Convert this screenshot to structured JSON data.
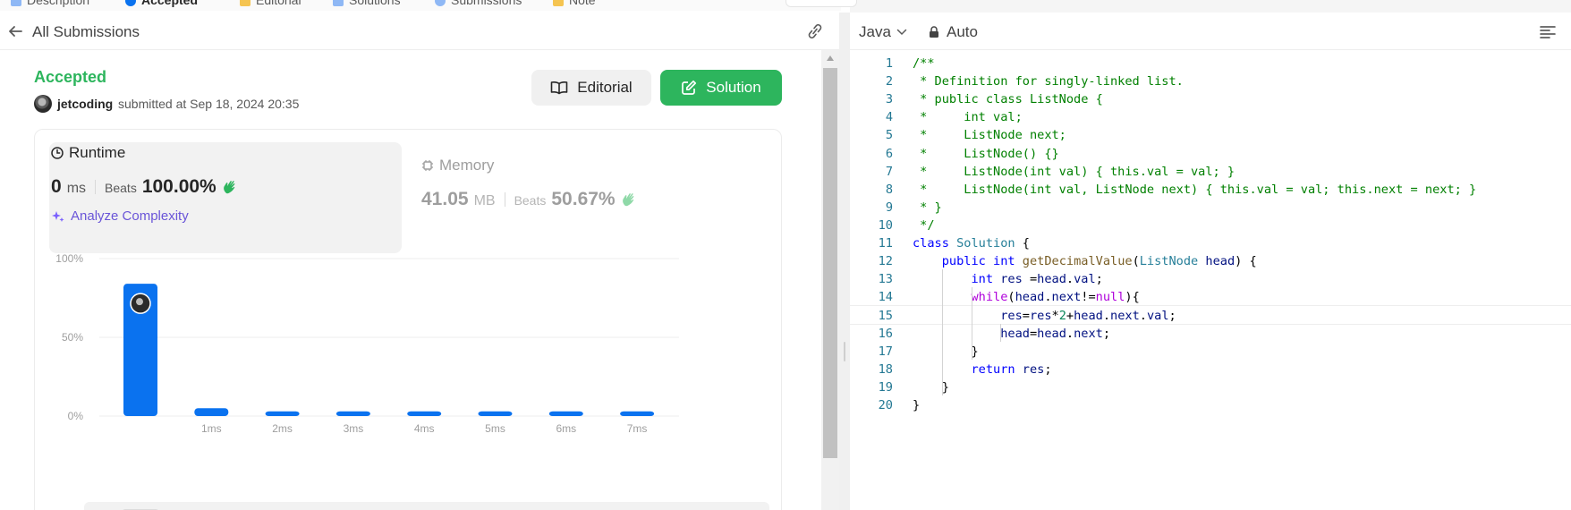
{
  "top_tabs": [
    "Description",
    "Accepted",
    "Editorial",
    "Solutions",
    "Submissions",
    "Note"
  ],
  "left_header": {
    "back_label": "All Submissions"
  },
  "submission": {
    "status": "Accepted",
    "user": "jetcoding",
    "submitted_at": "submitted at Sep 18, 2024 20:35"
  },
  "buttons": {
    "editorial": "Editorial",
    "solution": "Solution"
  },
  "runtime": {
    "title": "Runtime",
    "value": "0",
    "unit": "ms",
    "beats_label": "Beats",
    "beats": "100.00%"
  },
  "memory": {
    "title": "Memory",
    "value": "41.05",
    "unit": "MB",
    "beats_label": "Beats",
    "beats": "50.67%"
  },
  "analyze_label": "Analyze Complexity",
  "chart_data": {
    "type": "bar",
    "categories": [
      "",
      "1ms",
      "2ms",
      "3ms",
      "4ms",
      "5ms",
      "6ms",
      "7ms"
    ],
    "values": [
      84,
      5,
      3,
      3,
      3,
      3,
      3,
      3
    ],
    "y_ticks": [
      "0%",
      "50%",
      "100%"
    ],
    "ylim": [
      0,
      100
    ],
    "highlight_index": 0,
    "grid": true,
    "bar_color": "#0a72ef"
  },
  "editor": {
    "language": "Java",
    "mode": "Auto",
    "active_line": 15,
    "lines": [
      "/**",
      " * Definition for singly-linked list.",
      " * public class ListNode {",
      " *     int val;",
      " *     ListNode next;",
      " *     ListNode() {}",
      " *     ListNode(int val) { this.val = val; }",
      " *     ListNode(int val, ListNode next) { this.val = val; this.next = next; }",
      " * }",
      " */",
      "class Solution {",
      "    public int getDecimalValue(ListNode head) {",
      "        int res =head.val;",
      "        while(head.next!=null){",
      "            res=res*2+head.next.val;",
      "            head=head.next;",
      "        }",
      "        return res;",
      "    }",
      "}"
    ]
  },
  "colors": {
    "accepted": "#2db55d",
    "solution_button": "#2db55d",
    "bar": "#0a72ef",
    "analyze": "#6a55d8"
  }
}
